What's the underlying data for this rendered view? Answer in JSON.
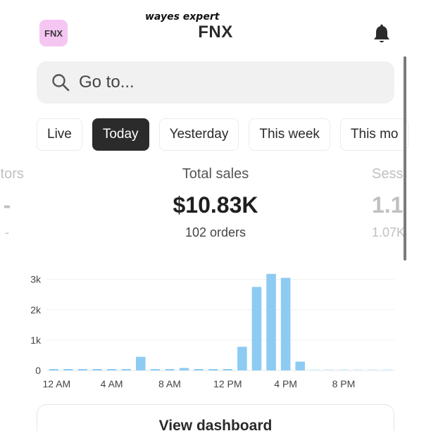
{
  "watermark": "wayes expert",
  "header": {
    "store_badge": "FNX",
    "title": "FNX",
    "notification_icon": "bell-icon"
  },
  "search": {
    "placeholder": "Go to...",
    "icon": "search-icon"
  },
  "tabs": [
    {
      "label": "Live",
      "active": false
    },
    {
      "label": "Today",
      "active": true
    },
    {
      "label": "Yesterday",
      "active": false
    },
    {
      "label": "This week",
      "active": false
    },
    {
      "label": "This mo",
      "active": false
    }
  ],
  "metrics": {
    "left": {
      "label": "sitors",
      "value": "-",
      "sub": "-"
    },
    "center": {
      "label": "Total sales",
      "value": "$10.83K",
      "sub": "102 orders"
    },
    "right": {
      "label": "Sess",
      "value": "1.1",
      "sub": "1.07K"
    }
  },
  "chart_data": {
    "type": "bar",
    "y_ticks": [
      "0",
      "1k",
      "2k",
      "3k"
    ],
    "ylim": [
      0,
      3200
    ],
    "x_tick_labels": [
      "12 AM",
      "4 AM",
      "8 AM",
      "12 PM",
      "4 PM",
      "8 PM"
    ],
    "x_tick_hours": [
      0,
      4,
      8,
      12,
      16,
      20
    ],
    "hours": [
      0,
      1,
      2,
      3,
      4,
      5,
      6,
      7,
      8,
      9,
      10,
      11,
      12,
      13,
      14,
      15,
      16,
      17,
      18,
      19,
      20,
      21,
      22,
      23
    ],
    "values": [
      40,
      40,
      40,
      40,
      40,
      40,
      450,
      40,
      40,
      80,
      40,
      40,
      40,
      780,
      2750,
      3180,
      3050,
      290,
      20,
      20,
      20,
      20,
      20,
      20
    ],
    "bar_color": "#8ecbf3",
    "faint_bar_color": "#dff0fb",
    "grid": true
  },
  "footer": {
    "button_label": "View dashboard"
  }
}
